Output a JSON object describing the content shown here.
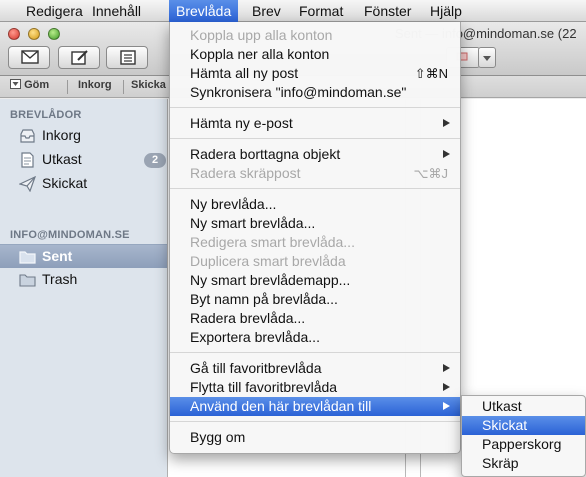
{
  "menubar": {
    "items": [
      "Redigera",
      "Innehåll",
      "Brevlåda",
      "Brev",
      "Format",
      "Fönster",
      "Hjälp"
    ]
  },
  "window": {
    "title": "Sent — info@mindoman.se (22"
  },
  "favorites": {
    "hide_label": "Göm",
    "inbox_label": "Inkorg",
    "sent_label": "Skicka"
  },
  "sidebar": {
    "mailboxes_header": "BREVLÅDOR",
    "inbox_label": "Inkorg",
    "drafts_label": "Utkast",
    "drafts_count": "2",
    "sent_label": "Skickat",
    "account_header": "INFO@MINDOMAN.SE",
    "account_sent": "Sent",
    "account_trash": "Trash"
  },
  "menu": {
    "take_online": "Koppla upp alla konton",
    "take_offline": "Koppla ner alla konton",
    "get_all_mail": "Hämta all ny post",
    "get_all_mail_shortcut": "⇧⌘N",
    "sync": "Synkronisera \"info@mindoman.se\"",
    "get_new_mail": "Hämta ny e-post",
    "erase_deleted": "Radera borttagna objekt",
    "erase_junk": "Radera skräppost",
    "erase_junk_shortcut": "⌥⌘J",
    "new_mailbox": "Ny brevlåda...",
    "new_smart_mailbox": "Ny smart brevlåda...",
    "edit_smart_mailbox": "Redigera smart brevlåda...",
    "duplicate_smart_mailbox": "Duplicera smart brevlåda",
    "new_smart_folder": "Ny smart brevlådemapp...",
    "rename_mailbox": "Byt namn på brevlåda...",
    "delete_mailbox": "Radera brevlåda...",
    "export_mailbox": "Exportera brevlåda...",
    "go_to_favorite": "Gå till favoritbrevlåda",
    "move_to_favorite": "Flytta till favoritbrevlåda",
    "use_mailbox_for": "Använd den här brevlådan till",
    "rebuild": "Bygg om"
  },
  "submenu": {
    "drafts": "Utkast",
    "sent": "Skickat",
    "trash": "Papperskorg",
    "junk": "Skräp"
  },
  "colors": {
    "highlight": "#3b74e0",
    "sidebar_bg": "#dde4ec",
    "selected_row": "#98a9c2"
  }
}
